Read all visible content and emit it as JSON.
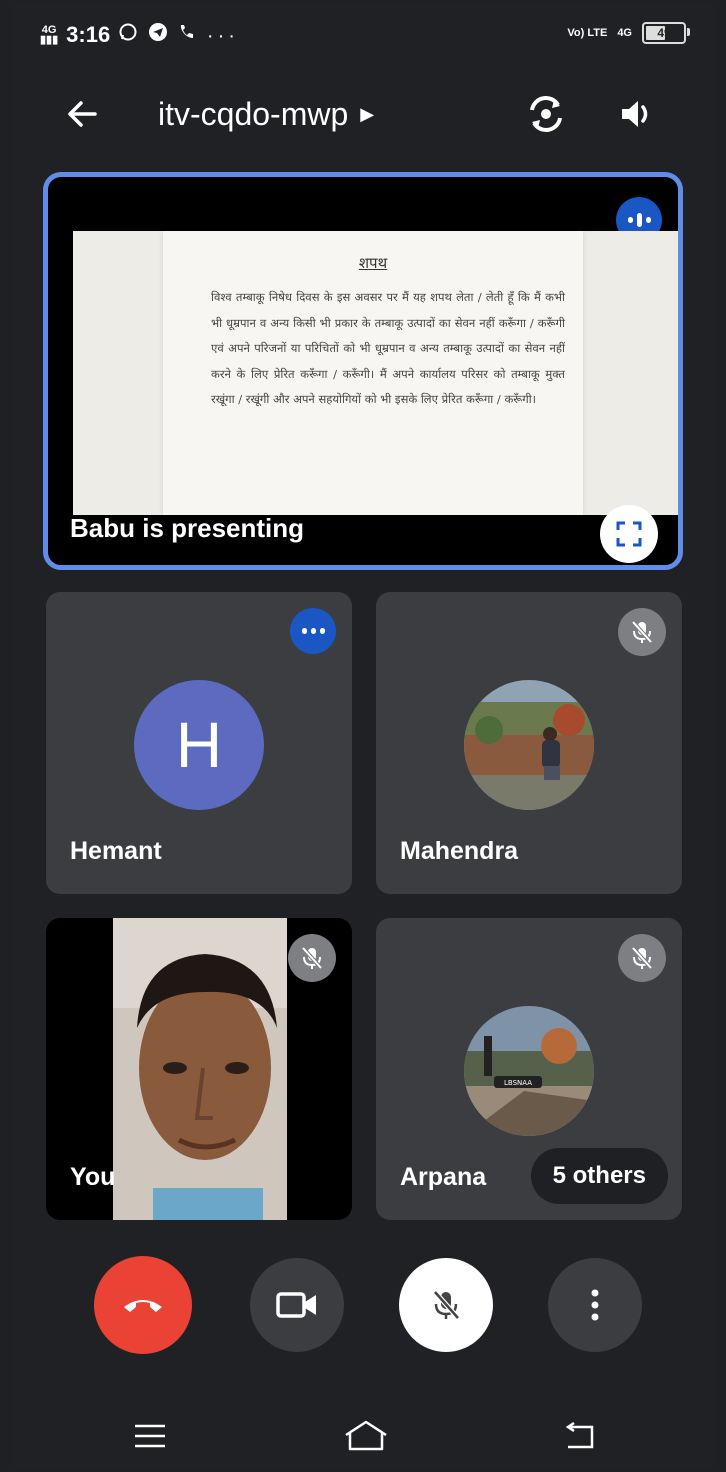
{
  "status_bar": {
    "network_type": "4G",
    "time": "3:16",
    "notification_icons": [
      "whatsapp-icon",
      "telegram-icon",
      "missed-call-icon",
      "more-dots-icon"
    ],
    "volte_label": "Vo) LTE",
    "data_label": "4G",
    "battery_level": "49"
  },
  "header": {
    "meeting_code": "itv-cqdo-mwp",
    "back_icon": "arrow-left-icon",
    "switch_camera_icon": "switch-camera-icon",
    "audio_icon": "speaker-icon"
  },
  "presentation": {
    "label": "Babu is presenting",
    "document_title": "शपथ",
    "document_body": "विश्व तम्बाकू निषेध दिवस के इस अवसर पर मैं यह शपथ लेता / लेती हूँ कि मैं कभी भी धूम्रपान व अन्य किसी भी प्रकार के तम्बाकू उत्पादों का सेवन नहीं करूँगा / करूँगी एवं अपने परिजनों या परिचितों को भी धूम्रपान व अन्य तम्बाकू उत्पादों का सेवन नहीं करने के लिए प्रेरित करूँगा / करूँगी। मैं अपने कार्यालय परिसर को तम्बाकू मुक्त रखूंगा / रखूंगी और अपने सहयोगियों को भी इसके लिए प्रेरित करूँगा / करूँगी।"
  },
  "participants": [
    {
      "name": "Hemant",
      "avatar_letter": "H",
      "status": "speaking"
    },
    {
      "name": "Mahendra",
      "status": "muted"
    },
    {
      "name": "You",
      "status": "muted"
    },
    {
      "name": "Arpana",
      "status": "muted",
      "photo_text": "LBSNAA"
    }
  ],
  "others_label": "5 others",
  "colors": {
    "background": "#202124",
    "tile": "#3c3d40",
    "accent_border": "#5f8de8",
    "speaking_badge": "#1a56c4",
    "end_call": "#ea4335",
    "avatar_h": "#5c6bc0"
  },
  "controls": [
    "end-call-icon",
    "camera-icon",
    "mic-off-icon",
    "more-vert-icon"
  ],
  "nav_bar": [
    "menu-icon",
    "home-icon",
    "back-icon"
  ]
}
